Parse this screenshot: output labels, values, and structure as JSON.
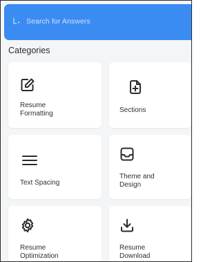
{
  "search": {
    "placeholder": "Search for Answers",
    "icon": "search-icon",
    "bar_color": "#3b8cf2"
  },
  "categories": {
    "title": "Categories",
    "items": [
      {
        "label": "Resume\nFormatting",
        "icon": "edit-icon"
      },
      {
        "label": "Sections",
        "icon": "add-section-icon"
      },
      {
        "label": "Text Spacing",
        "icon": "lines-icon"
      },
      {
        "label": "Theme and\nDesign",
        "icon": "inbox-icon"
      },
      {
        "label": "Resume\nOptimization",
        "icon": "gear-icon"
      },
      {
        "label": "Resume\nDownload",
        "icon": "download-icon"
      }
    ]
  }
}
